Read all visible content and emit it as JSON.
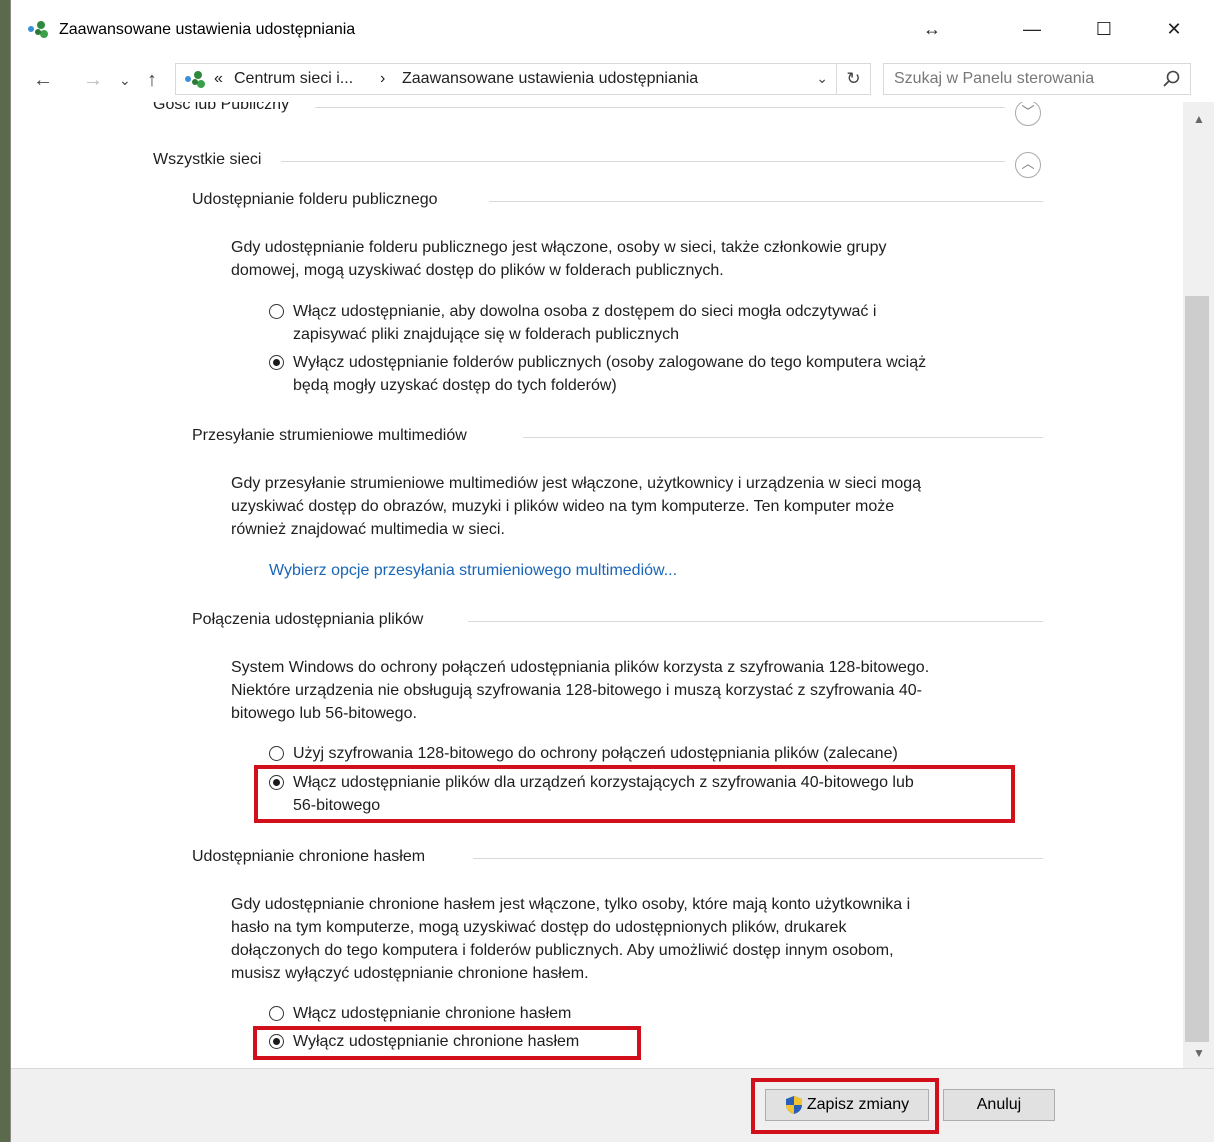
{
  "window": {
    "title": "Zaawansowane ustawienia udostępniania",
    "controls": {
      "resize": "↔",
      "minimize": "—",
      "maximize": "☐",
      "close": "✕"
    }
  },
  "nav": {
    "back": "←",
    "forward": "→",
    "recent": "⌄",
    "up": "↑",
    "breadcrumb_overflow": "«",
    "crumb1": "Centrum sieci i...",
    "separator": "›",
    "crumb2": "Zaawansowane ustawienia udostępniania",
    "dropdown": "⌄",
    "refresh": "↻",
    "search_placeholder": "Szukaj w Panelu sterowania"
  },
  "sections": {
    "guest": {
      "title": "Gość lub Publiczny",
      "chevron": "﹀"
    },
    "all": {
      "title": "Wszystkie sieci",
      "chevron": "︿"
    }
  },
  "public_folder": {
    "title": "Udostępnianie folderu publicznego",
    "desc_line1": "Gdy udostępnianie folderu publicznego jest włączone, osoby w sieci, także członkowie grupy",
    "desc_line2": "domowej, mogą uzyskiwać dostęp do plików w folderach publicznych.",
    "opt1_line1": "Włącz udostępnianie, aby dowolna osoba z dostępem do sieci mogła odczytywać i",
    "opt1_line2": "zapisywać pliki znajdujące się w folderach publicznych",
    "opt2_line1": "Wyłącz udostępnianie folderów publicznych (osoby zalogowane do tego komputera wciąż",
    "opt2_line2": "będą mogły uzyskać dostęp do tych folderów)",
    "selected": 2
  },
  "media": {
    "title": "Przesyłanie strumieniowe multimediów",
    "desc_line1": "Gdy przesyłanie strumieniowe multimediów jest włączone, użytkownicy i urządzenia w sieci mogą",
    "desc_line2": "uzyskiwać dostęp do obrazów, muzyki i plików wideo na tym komputerze. Ten komputer może",
    "desc_line3": "również znajdować multimedia w sieci.",
    "link": "Wybierz opcje przesyłania strumieniowego multimediów..."
  },
  "file_sharing": {
    "title": "Połączenia udostępniania plików",
    "desc_line1": "System Windows do ochrony połączeń udostępniania plików korzysta z szyfrowania 128-bitowego.",
    "desc_line2": "Niektóre urządzenia nie obsługują szyfrowania 128-bitowego i muszą korzystać z szyfrowania 40-",
    "desc_line3": "bitowego lub 56-bitowego.",
    "opt1": "Użyj szyfrowania 128-bitowego do ochrony połączeń udostępniania plików (zalecane)",
    "opt2_line1": "Włącz udostępnianie plików dla urządzeń korzystających z szyfrowania 40-bitowego lub",
    "opt2_line2": "56-bitowego",
    "selected": 2
  },
  "password": {
    "title": "Udostępnianie chronione hasłem",
    "desc_line1": "Gdy udostępnianie chronione hasłem jest włączone, tylko osoby, które mają konto użytkownika i",
    "desc_line2": "hasło na tym komputerze, mogą uzyskiwać dostęp do udostępnionych plików, drukarek",
    "desc_line3": "dołączonych do tego komputera i folderów publicznych. Aby umożliwić dostęp innym osobom,",
    "desc_line4": "musisz wyłączyć udostępnianie chronione hasłem.",
    "opt1": "Włącz udostępnianie chronione hasłem",
    "opt2": "Wyłącz udostępnianie chronione hasłem",
    "selected": 2
  },
  "footer": {
    "save": "Zapisz zmiany",
    "cancel": "Anuluj"
  },
  "colors": {
    "highlight": "#d2101c",
    "link": "#1a65b8"
  }
}
